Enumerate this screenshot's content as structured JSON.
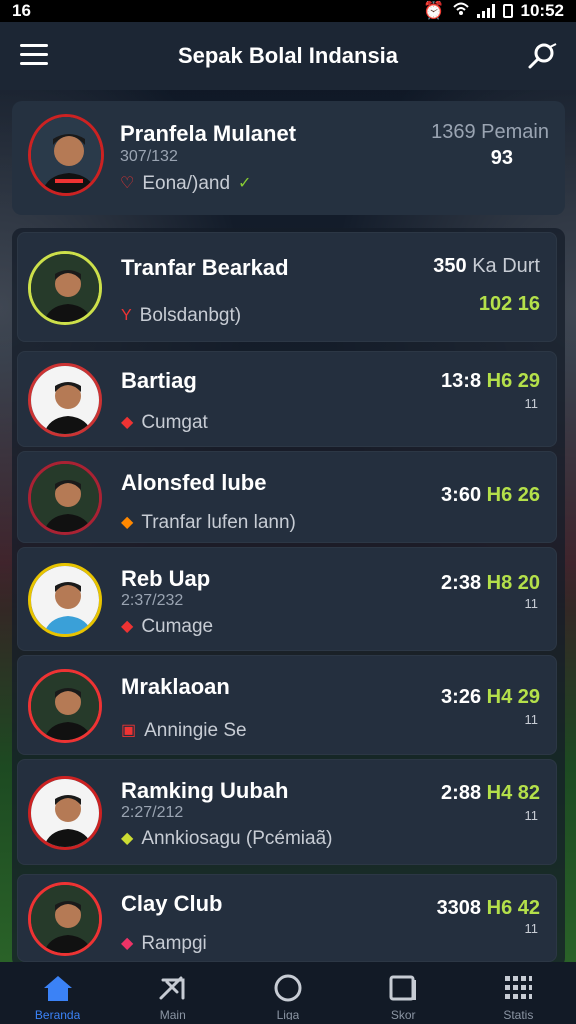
{
  "status_bar": {
    "time_left": "16",
    "clock": "10:52"
  },
  "app_bar": {
    "title": "Sepak Bolal Indansia"
  },
  "featured": {
    "name": "Pranfela Mulanet",
    "date": "307/132",
    "tagline": "Eona/)and",
    "stat_top": "1369 Pemain",
    "stat_bottom": "93"
  },
  "clubs": [
    {
      "name": "Tranfar Bearkad",
      "date": "",
      "tagline": "Bolsdanbgt)",
      "stat_white": "350",
      "stat_gray": "Ka Durt",
      "stat_green": "102 16",
      "small": "",
      "icon": "player-icon",
      "color": "#e33"
    },
    {
      "name": "Bartiag",
      "date": "",
      "tagline": "Cumgat",
      "stat_white": "13:8",
      "stat_gray": "",
      "stat_green": "H6 29",
      "small": "11",
      "icon": "shield-icon",
      "color": "#e33"
    },
    {
      "name": "Alonsfed lube",
      "date": "",
      "tagline": "Tranfar lufen lann)",
      "stat_white": "3:60",
      "stat_gray": "",
      "stat_green": "H6 26",
      "small": "",
      "icon": "crest-icon",
      "color": "#f80"
    },
    {
      "name": "Reb Uap",
      "date": "2:37/232",
      "tagline": "Cumage",
      "stat_white": "2:38",
      "stat_gray": "",
      "stat_green": "H8 20",
      "small": "11",
      "icon": "heart-icon",
      "color": "#e33"
    },
    {
      "name": "Mraklaoan",
      "date": "",
      "tagline": "Anningie Se",
      "stat_white": "3:26",
      "stat_gray": "",
      "stat_green": "H4 29",
      "small": "11",
      "icon": "flag-icon",
      "color": "#e33"
    },
    {
      "name": "Ramking Uubah",
      "date": "2:27/212",
      "tagline": "Annkiosagu (Pcémiaã)",
      "stat_white": "2:88",
      "stat_gray": "",
      "stat_green": "H4 82",
      "small": "11",
      "icon": "chart-icon",
      "color": "#cd3"
    },
    {
      "name": "Clay Club",
      "date": "",
      "tagline": "Rampgi",
      "stat_white": "3308",
      "stat_gray": "",
      "stat_green": "H6 42",
      "small": "11",
      "icon": "gift-icon",
      "color": "#e36"
    }
  ],
  "bottom_nav": [
    {
      "label": "Beranda",
      "icon": "home-icon"
    },
    {
      "label": "Main",
      "icon": "ball-icon"
    },
    {
      "label": "Liga",
      "icon": "circle-icon"
    },
    {
      "label": "Skor",
      "icon": "book-icon"
    },
    {
      "label": "Statis",
      "icon": "grid-icon"
    }
  ]
}
